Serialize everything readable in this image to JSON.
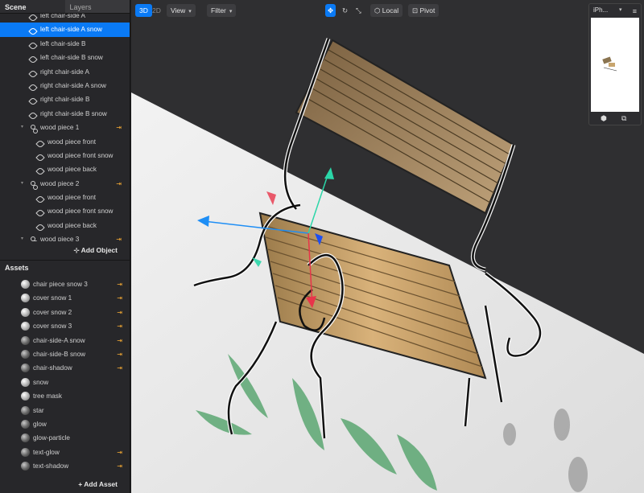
{
  "panel_tabs": {
    "scene": "Scene",
    "layers": "Layers"
  },
  "tree": [
    {
      "label": "left chair-side A",
      "indent": 2,
      "type": "mesh",
      "partial": true
    },
    {
      "label": "left chair-side A snow",
      "indent": 2,
      "type": "mesh",
      "selected": true
    },
    {
      "label": "left chair-side B",
      "indent": 2,
      "type": "mesh"
    },
    {
      "label": "left chair-side B snow",
      "indent": 2,
      "type": "mesh"
    },
    {
      "label": "right chair-side A",
      "indent": 2,
      "type": "mesh"
    },
    {
      "label": "right chair-side A snow",
      "indent": 2,
      "type": "mesh"
    },
    {
      "label": "right chair-side B",
      "indent": 2,
      "type": "mesh"
    },
    {
      "label": "right chair-side B snow",
      "indent": 2,
      "type": "mesh"
    },
    {
      "label": "wood piece 1",
      "indent": 1,
      "type": "group",
      "expanded": true,
      "link": true
    },
    {
      "label": "wood piece front",
      "indent": 3,
      "type": "mesh"
    },
    {
      "label": "wood piece front snow",
      "indent": 3,
      "type": "mesh"
    },
    {
      "label": "wood piece back",
      "indent": 3,
      "type": "mesh"
    },
    {
      "label": "wood piece 2",
      "indent": 1,
      "type": "group",
      "expanded": true,
      "link": true
    },
    {
      "label": "wood piece front",
      "indent": 3,
      "type": "mesh"
    },
    {
      "label": "wood piece front snow",
      "indent": 3,
      "type": "mesh"
    },
    {
      "label": "wood piece back",
      "indent": 3,
      "type": "mesh"
    },
    {
      "label": "wood piece 3",
      "indent": 1,
      "type": "group",
      "expanded": true,
      "link": true
    }
  ],
  "add_object_label": "Add Object",
  "assets_title": "Assets",
  "assets": [
    {
      "label": "chair piece snow 3",
      "link": true,
      "dark": false
    },
    {
      "label": "cover snow 1",
      "link": true,
      "dark": false
    },
    {
      "label": "cover snow 2",
      "link": true,
      "dark": false
    },
    {
      "label": "cover snow 3",
      "link": true,
      "dark": false
    },
    {
      "label": "chair-side-A snow",
      "link": true,
      "dark": true
    },
    {
      "label": "chair-side-B snow",
      "link": true,
      "dark": true
    },
    {
      "label": "chair-shadow",
      "link": true,
      "dark": true
    },
    {
      "label": "snow",
      "link": false,
      "dark": false
    },
    {
      "label": "tree mask",
      "link": false,
      "dark": false
    },
    {
      "label": "star",
      "link": false,
      "dark": true
    },
    {
      "label": "glow",
      "link": false,
      "dark": true
    },
    {
      "label": "glow-particle",
      "link": false,
      "dark": true
    },
    {
      "label": "text-glow",
      "link": true,
      "dark": true
    },
    {
      "label": "text-shadow",
      "link": true,
      "dark": true
    }
  ],
  "add_asset_label": "Add Asset",
  "toolbar": {
    "mode_3d": "3D",
    "mode_2d": "2D",
    "view": "View",
    "filter": "Filter",
    "space": "Local",
    "pivot": "Pivot"
  },
  "device": {
    "name": "iPh..."
  },
  "colors": {
    "accent": "#0a7af5",
    "link": "#f4a934",
    "gizmo_x": "#e8344a",
    "gizmo_y": "#2bd6a8",
    "gizmo_z": "#1e8ef5"
  },
  "icons": {
    "move": "move-arrows-icon",
    "rotate": "rotate-icon",
    "scale": "scale-icon",
    "local": "cube-icon",
    "pivot": "pivot-icon",
    "link": "link-arrow-icon"
  }
}
